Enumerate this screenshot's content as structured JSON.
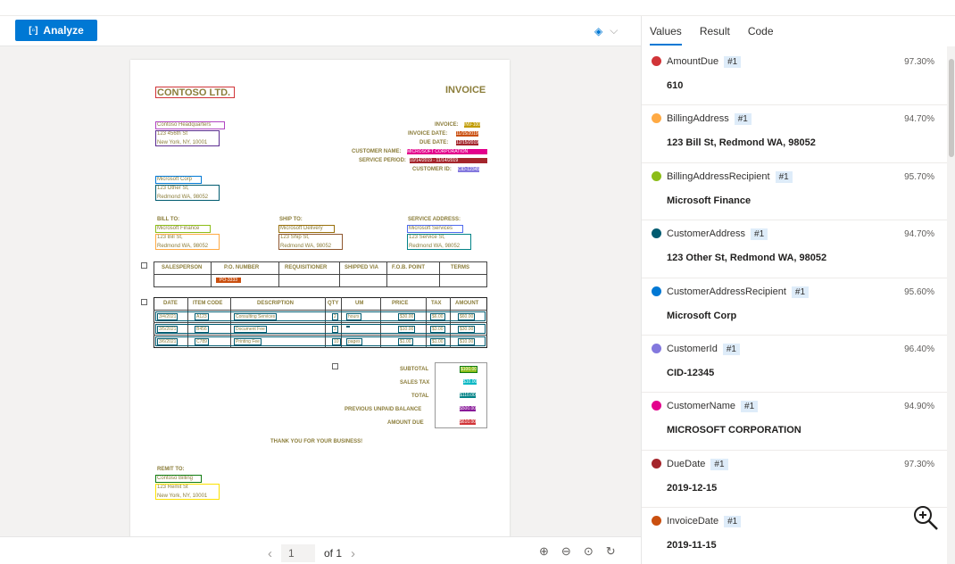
{
  "toolbar": {
    "analyze_label": "Analyze"
  },
  "document": {
    "company": "CONTOSO LTD.",
    "title": "INVOICE",
    "addr_lines": [
      "Contoso Headquarters",
      "123 456th St",
      "New York, NY, 10001"
    ],
    "invoice_labels": [
      "INVOICE:",
      "INVOICE DATE:",
      "DUE DATE:",
      "CUSTOMER NAME:",
      "SERVICE PERIOD:",
      "CUSTOMER ID:"
    ],
    "invoice_values": [
      "INV-100",
      "11/15/2019",
      "12/15/2019",
      "MICROSOFT CORPORATION",
      "10/14/2019 - 11/14/2019",
      "CID-12345"
    ],
    "cust_lines": [
      "Microsoft Corp",
      "123 Other St,",
      "Redmond WA, 98052"
    ],
    "bill_to": "BILL TO:",
    "ship_to": "SHIP TO:",
    "service_address": "SERVICE ADDRESS:",
    "bill_lines": [
      "Microsoft Finance",
      "123 Bill St,",
      "Redmond WA, 98052"
    ],
    "ship_lines": [
      "Microsoft Delivery",
      "123 Ship St,",
      "Redmond WA, 98052"
    ],
    "service_lines": [
      "Microsoft Services",
      "123 Service St,",
      "Redmond WA, 98052"
    ],
    "sales_headers": [
      "SALESPERSON",
      "P.O. NUMBER",
      "REQUISITIONER",
      "SHIPPED VIA",
      "F.O.B. POINT",
      "TERMS"
    ],
    "po_number": "PO-3333",
    "item_headers": [
      "DATE",
      "ITEM CODE",
      "DESCRIPTION",
      "QTY",
      "UM",
      "PRICE",
      "TAX",
      "AMOUNT"
    ],
    "items": [
      [
        "3/4/2021",
        "A123",
        "Consulting Services",
        "2",
        "hours",
        "$30.00",
        "$6.00",
        "$60.00"
      ],
      [
        "3/5/2021",
        "B456",
        "Document Fee",
        "3",
        "",
        "$10.00",
        "$3.00",
        "$30.00"
      ],
      [
        "3/6/2021",
        "C789",
        "Printing Fee",
        "10",
        "pages",
        "$1.00",
        "$1.00",
        "$10.00"
      ]
    ],
    "totals_labels": [
      "SUBTOTAL",
      "SALES TAX",
      "TOTAL",
      "PREVIOUS UNPAID BALANCE",
      "AMOUNT DUE"
    ],
    "totals_values": [
      "$100.00",
      "$10.00",
      "$110.00",
      "$500.00",
      "$610.00"
    ],
    "thanks": "THANK YOU FOR YOUR BUSINESS!",
    "remit_to": "REMIT TO:",
    "remit_lines": [
      "Contoso Billing",
      "123 Remit St",
      "New York, NY, 10001"
    ]
  },
  "pager": {
    "page": "1",
    "of_label": "of 1"
  },
  "tabs": [
    "Values",
    "Result",
    "Code"
  ],
  "fields": [
    {
      "name": "AmountDue",
      "index": "#1",
      "confidence": "97.30%",
      "value": "610",
      "color": "#d13438"
    },
    {
      "name": "BillingAddress",
      "index": "#1",
      "confidence": "94.70%",
      "value": "123 Bill St, Redmond WA, 98052",
      "color": "#ffaa44"
    },
    {
      "name": "BillingAddressRecipient",
      "index": "#1",
      "confidence": "95.70%",
      "value": "Microsoft Finance",
      "color": "#8cbd18"
    },
    {
      "name": "CustomerAddress",
      "index": "#1",
      "confidence": "94.70%",
      "value": "123 Other St, Redmond WA, 98052",
      "color": "#005b70"
    },
    {
      "name": "CustomerAddressRecipient",
      "index": "#1",
      "confidence": "95.60%",
      "value": "Microsoft Corp",
      "color": "#0078d4"
    },
    {
      "name": "CustomerId",
      "index": "#1",
      "confidence": "96.40%",
      "value": "CID-12345",
      "color": "#8378de"
    },
    {
      "name": "CustomerName",
      "index": "#1",
      "confidence": "94.90%",
      "value": "MICROSOFT CORPORATION",
      "color": "#e3008c"
    },
    {
      "name": "DueDate",
      "index": "#1",
      "confidence": "97.30%",
      "value": "2019-12-15",
      "color": "#a4262c"
    },
    {
      "name": "InvoiceDate",
      "index": "#1",
      "confidence": "",
      "value": "2019-11-15",
      "color": "#ca5010"
    }
  ]
}
